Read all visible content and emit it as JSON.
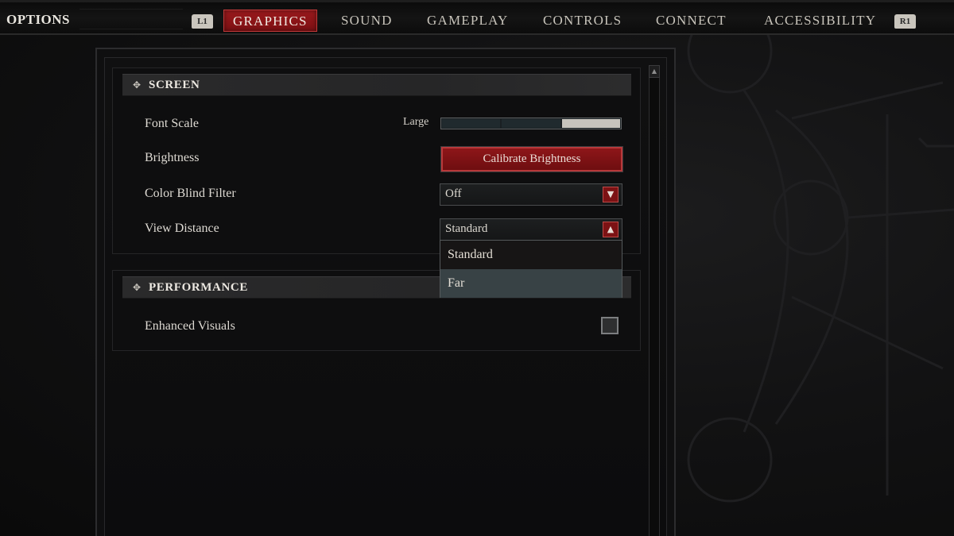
{
  "header": {
    "title": "OPTIONS",
    "left_bumper": "L1",
    "right_bumper": "R1",
    "tabs": [
      {
        "label": "GRAPHICS",
        "active": true
      },
      {
        "label": "SOUND",
        "active": false
      },
      {
        "label": "GAMEPLAY",
        "active": false
      },
      {
        "label": "CONTROLS",
        "active": false
      },
      {
        "label": "CONNECT",
        "active": false
      },
      {
        "label": "ACCESSIBILITY",
        "active": false
      }
    ]
  },
  "colors": {
    "accent_red": "#8e1619",
    "highlight_option": "#384245",
    "slider_fill": "#c7c4bd"
  },
  "sections": {
    "screen": {
      "title": "SCREEN",
      "font_scale": {
        "label": "Font Scale",
        "value": "Large",
        "level": 3,
        "levels": 3
      },
      "brightness": {
        "label": "Brightness",
        "button": "Calibrate Brightness"
      },
      "color_blind": {
        "label": "Color Blind Filter",
        "value": "Off"
      },
      "view_distance": {
        "label": "View Distance",
        "value": "Standard",
        "expanded": true,
        "options": [
          "Standard",
          "Far"
        ],
        "highlighted": "Far"
      }
    },
    "performance": {
      "title": "PERFORMANCE",
      "enhanced_visuals": {
        "label": "Enhanced Visuals",
        "checked": false
      }
    }
  },
  "icons": {
    "section_marker": "✥",
    "dropdown_down": "▼",
    "dropdown_up": "▲",
    "scroll_up": "▲"
  }
}
